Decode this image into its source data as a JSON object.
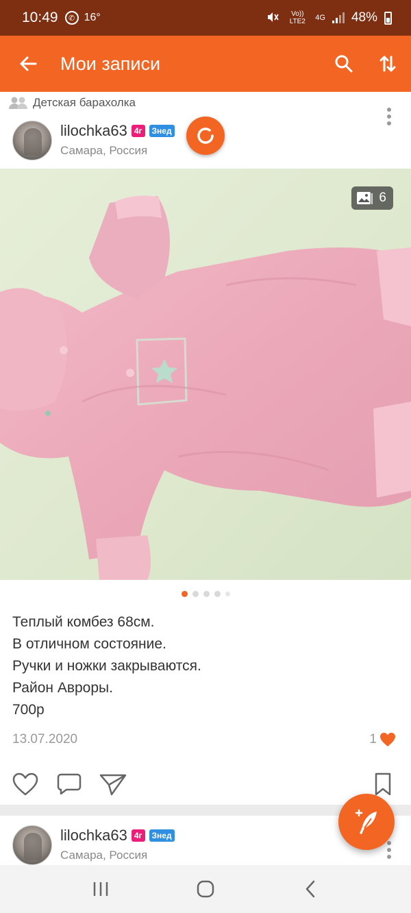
{
  "status_bar": {
    "time": "10:49",
    "temperature": "16°",
    "network_label": "Vo)) LTE2",
    "network_type": "4G",
    "battery": "48%"
  },
  "toolbar": {
    "title": "Мои записи"
  },
  "post": {
    "group_name": "Детская барахолка",
    "author": {
      "name": "lilochka63",
      "badge_age": "4г",
      "badge_sign": "Знед",
      "location": "Самара, Россия"
    },
    "photo_count": "6",
    "pager": {
      "total": 5,
      "active_index": 0
    },
    "text_lines": [
      "Теплый комбез 68см.",
      "В отличном состояние.",
      "Ручки и ножки закрываются.",
      "Район Авроры.",
      "700р"
    ],
    "date": "13.07.2020",
    "likes_count": "1"
  },
  "post2": {
    "author": {
      "name": "lilochka63",
      "badge_age": "4г",
      "badge_sign": "Знед",
      "location": "Самара, Россия"
    }
  },
  "colors": {
    "status_bar": "#7e2f12",
    "accent": "#f26522",
    "like": "#f26522",
    "badge_pink": "#ed1e79",
    "badge_blue": "#2f8fe0"
  },
  "icons": {
    "back": "arrow-left-icon",
    "search": "search-icon",
    "sort": "sort-arrows-icon",
    "photos": "gallery-icon",
    "like": "heart-outline-icon",
    "comment": "comment-icon",
    "share": "send-icon",
    "bookmark": "bookmark-icon",
    "compose": "feather-plus-icon"
  }
}
